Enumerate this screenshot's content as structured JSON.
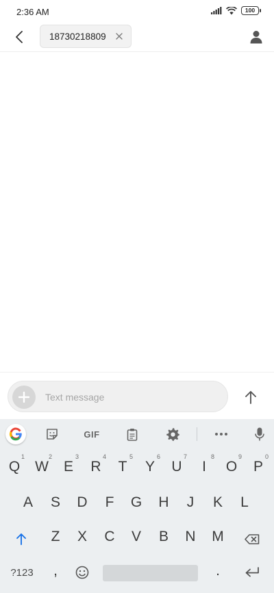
{
  "status_bar": {
    "time": "2:36 AM",
    "battery": "100"
  },
  "conversation": {
    "recipient": "18730218809"
  },
  "compose": {
    "placeholder": "Text message"
  },
  "keyboard": {
    "toolbar": {
      "gif_label": "GIF"
    },
    "row1": [
      {
        "key": "Q",
        "hint": "1"
      },
      {
        "key": "W",
        "hint": "2"
      },
      {
        "key": "E",
        "hint": "3"
      },
      {
        "key": "R",
        "hint": "4"
      },
      {
        "key": "T",
        "hint": "5"
      },
      {
        "key": "Y",
        "hint": "6"
      },
      {
        "key": "U",
        "hint": "7"
      },
      {
        "key": "I",
        "hint": "8"
      },
      {
        "key": "O",
        "hint": "9"
      },
      {
        "key": "P",
        "hint": "0"
      }
    ],
    "row2": [
      "A",
      "S",
      "D",
      "F",
      "G",
      "H",
      "J",
      "K",
      "L"
    ],
    "row3": [
      "Z",
      "X",
      "C",
      "V",
      "B",
      "N",
      "M"
    ],
    "row4": {
      "symbols": "?123",
      "comma": ",",
      "period": "."
    },
    "colors": {
      "shift": "#1a73e8",
      "background": "#eceff1"
    }
  }
}
